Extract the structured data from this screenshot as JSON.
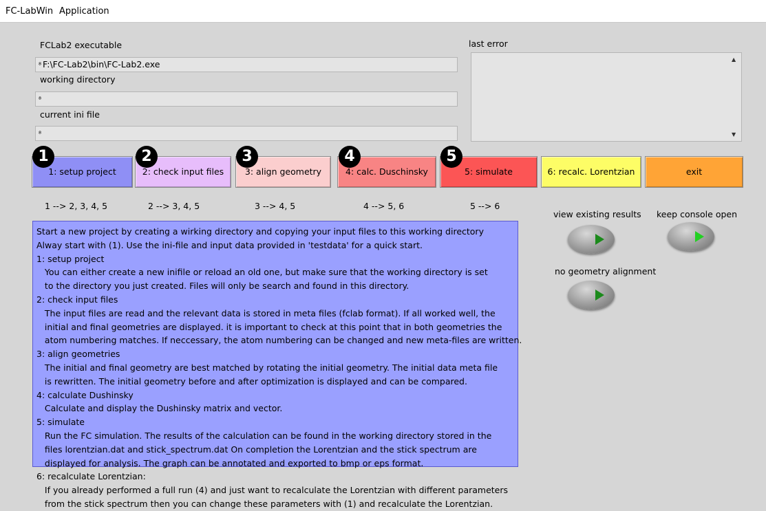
{
  "menu": [
    "FC-LabWin",
    "Application"
  ],
  "fields": {
    "exe_label": "FCLab2 executable",
    "exe_value": "F:\\FC-Lab2\\bin\\FC-Lab2.exe",
    "workdir_label": "working directory",
    "workdir_value": "",
    "ini_label": "current ini file",
    "ini_value": "",
    "path_glyph": "⁸"
  },
  "error": {
    "label": "last error",
    "value": ""
  },
  "buttons": [
    {
      "label": "1: setup project",
      "badge": "1",
      "color": "#8f8ff5"
    },
    {
      "label": "2: check input files",
      "badge": "2",
      "color": "#e7bdfb"
    },
    {
      "label": "3: align geometry",
      "badge": "3",
      "color": "#fbcece"
    },
    {
      "label": "4: calc. Duschinsky",
      "badge": "4",
      "color": "#f88484"
    },
    {
      "label": "5: simulate",
      "badge": "5",
      "color": "#fc5555"
    },
    {
      "label": "6: recalc. Lorentzian",
      "color": "#fdfd66"
    },
    {
      "label": "exit",
      "color": "#ffa436"
    }
  ],
  "dependencies": [
    "1 --> 2, 3, 4, 5",
    "2 --> 3, 4, 5",
    "3 --> 4, 5",
    "4 --> 5, 6",
    "5 --> 6"
  ],
  "toggles": {
    "view_existing_results": "view existing results",
    "keep_console_open": "keep console open",
    "no_geometry_alignment": "no geometry alignment"
  },
  "help_lines": [
    "Start a new project by creating a wirking directory and copying your input files to this working directory",
    "Alway start with (1). Use the ini-file and input data provided in 'testdata' for a quick start.",
    "1: setup project",
    "   You can either create a new inifile or reload an old one, but make sure that the working directory is set",
    "   to the directory you just created. Files will only be search and found in this directory.",
    "2: check input files",
    "   The input files are read and the relevant data is stored in meta files (fclab format). If all worked well, the",
    "   initial and final geometries are displayed. it is important to check at this point that in both geometries the",
    "   atom numbering matches. If neccessary, the atom numbering can be changed and new meta-files are written.",
    "3: align geometries",
    "   The initial and final geometry are best matched by rotating the initial geometry. The initial data meta file",
    "   is rewritten. The initial geometry before and after optimization is displayed and can be compared.",
    "4: calculate Dushinsky",
    "   Calculate and display the Dushinsky matrix and vector.",
    "5: simulate",
    "   Run the FC simulation. The results of the calculation can be found in the working directory stored in the",
    "   files lorentzian.dat and stick_spectrum.dat On completion the Lorentzian and the stick spectrum are",
    "   displayed for analysis. The graph can be annotated and exported to bmp or eps format.",
    "6: recalculate Lorentzian:",
    "   If you already performed a full run (4) and just want to recalculate the Lorentzian with different parameters",
    "   from the stick spectrum then you can change these parameters with (1) and recalculate the Lorentzian."
  ]
}
